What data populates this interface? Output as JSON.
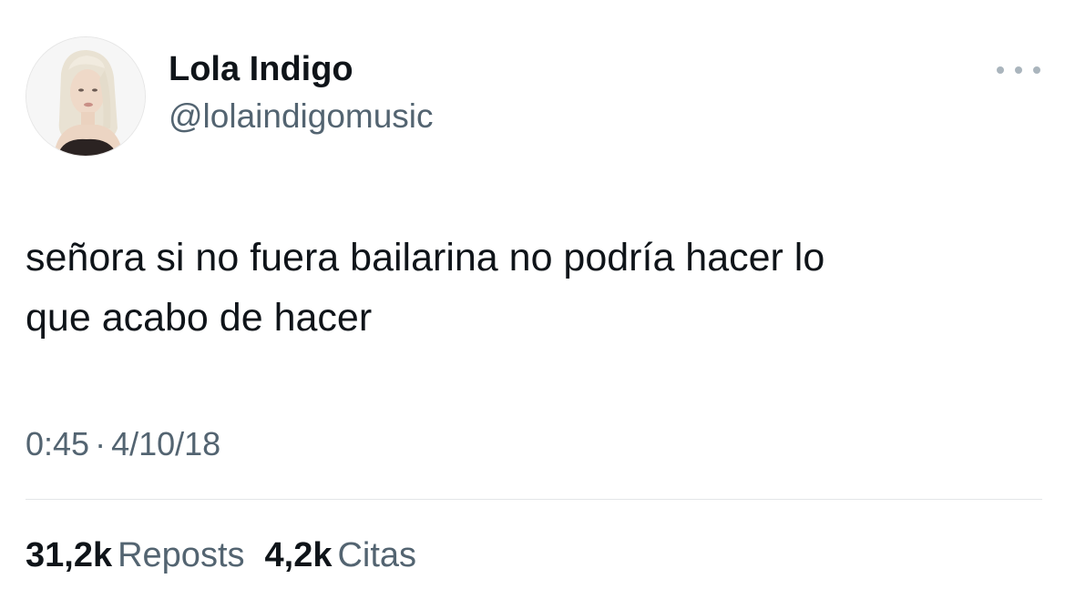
{
  "author": {
    "display_name": "Lola Indigo",
    "handle": "@lolaindigomusic"
  },
  "more_icon": "more-horizontal-icon",
  "tweet": {
    "text_line1": "señora si no fuera bailarina no podría hacer lo",
    "text_line2": "que acabo de hacer",
    "time": "0:45",
    "separator": "·",
    "date": "4/10/18"
  },
  "stats": {
    "reposts_count": "31,2k",
    "reposts_label": "Reposts",
    "quotes_count": "4,2k",
    "quotes_label": "Citas"
  },
  "colors": {
    "text": "#0f1419",
    "secondary": "#536471",
    "divider": "#e3e6e8"
  }
}
